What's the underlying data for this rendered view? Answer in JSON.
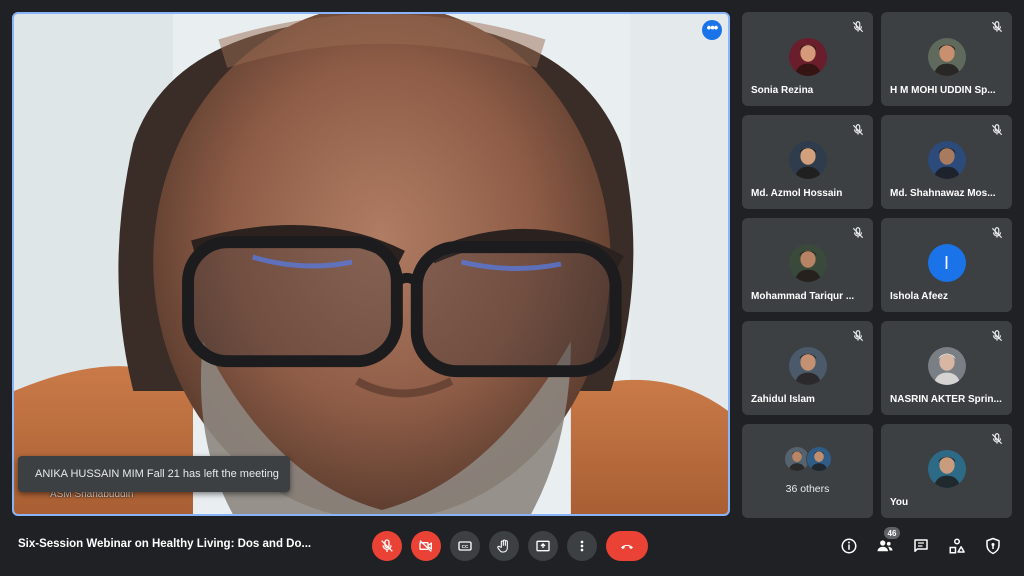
{
  "meeting": {
    "title": "Six-Session Webinar on Healthy Living: Dos and Do...",
    "participant_count": "46"
  },
  "main_speaker": {
    "name": "ASM Shahabuddin",
    "more_options_icon": "more-vert-icon",
    "background_color": "#6b4a38"
  },
  "notification": {
    "text": "ANIKA HUSSAIN MIM Fall 21 has left the meeting"
  },
  "participants": [
    {
      "name": "Sonia Rezina",
      "muted": true,
      "avatar": "photo"
    },
    {
      "name": "H M MOHI UDDIN Sp...",
      "muted": true,
      "avatar": "photo"
    },
    {
      "name": "Md. Azmol Hossain",
      "muted": true,
      "avatar": "photo"
    },
    {
      "name": "Md. Shahnawaz Mos...",
      "muted": true,
      "avatar": "photo"
    },
    {
      "name": "Mohammad Tariqur ...",
      "muted": true,
      "avatar": "photo"
    },
    {
      "name": "Ishola Afeez",
      "muted": true,
      "avatar": "letter",
      "letter": "I"
    },
    {
      "name": "Zahidul Islam",
      "muted": true,
      "avatar": "photo"
    },
    {
      "name": "NASRIN AKTER Sprin...",
      "muted": true,
      "avatar": "photo"
    },
    {
      "name": "36 others",
      "muted": false,
      "avatar": "group"
    },
    {
      "name": "You",
      "muted": true,
      "avatar": "photo"
    }
  ],
  "controls": {
    "mic": "mic-off-icon",
    "camera": "videocam-off-icon",
    "captions": "closed-caption-icon",
    "raise_hand": "hand-icon",
    "present": "present-screen-icon",
    "more": "more-vert-icon",
    "end_call": "call-end-icon"
  },
  "right_controls": [
    "info-icon",
    "people-icon",
    "chat-icon",
    "activities-icon",
    "host-controls-icon"
  ],
  "colors": {
    "background": "#202124",
    "tile": "#3c4043",
    "accent": "#8ab4f8",
    "danger": "#ea4335",
    "primary": "#1a73e8"
  }
}
